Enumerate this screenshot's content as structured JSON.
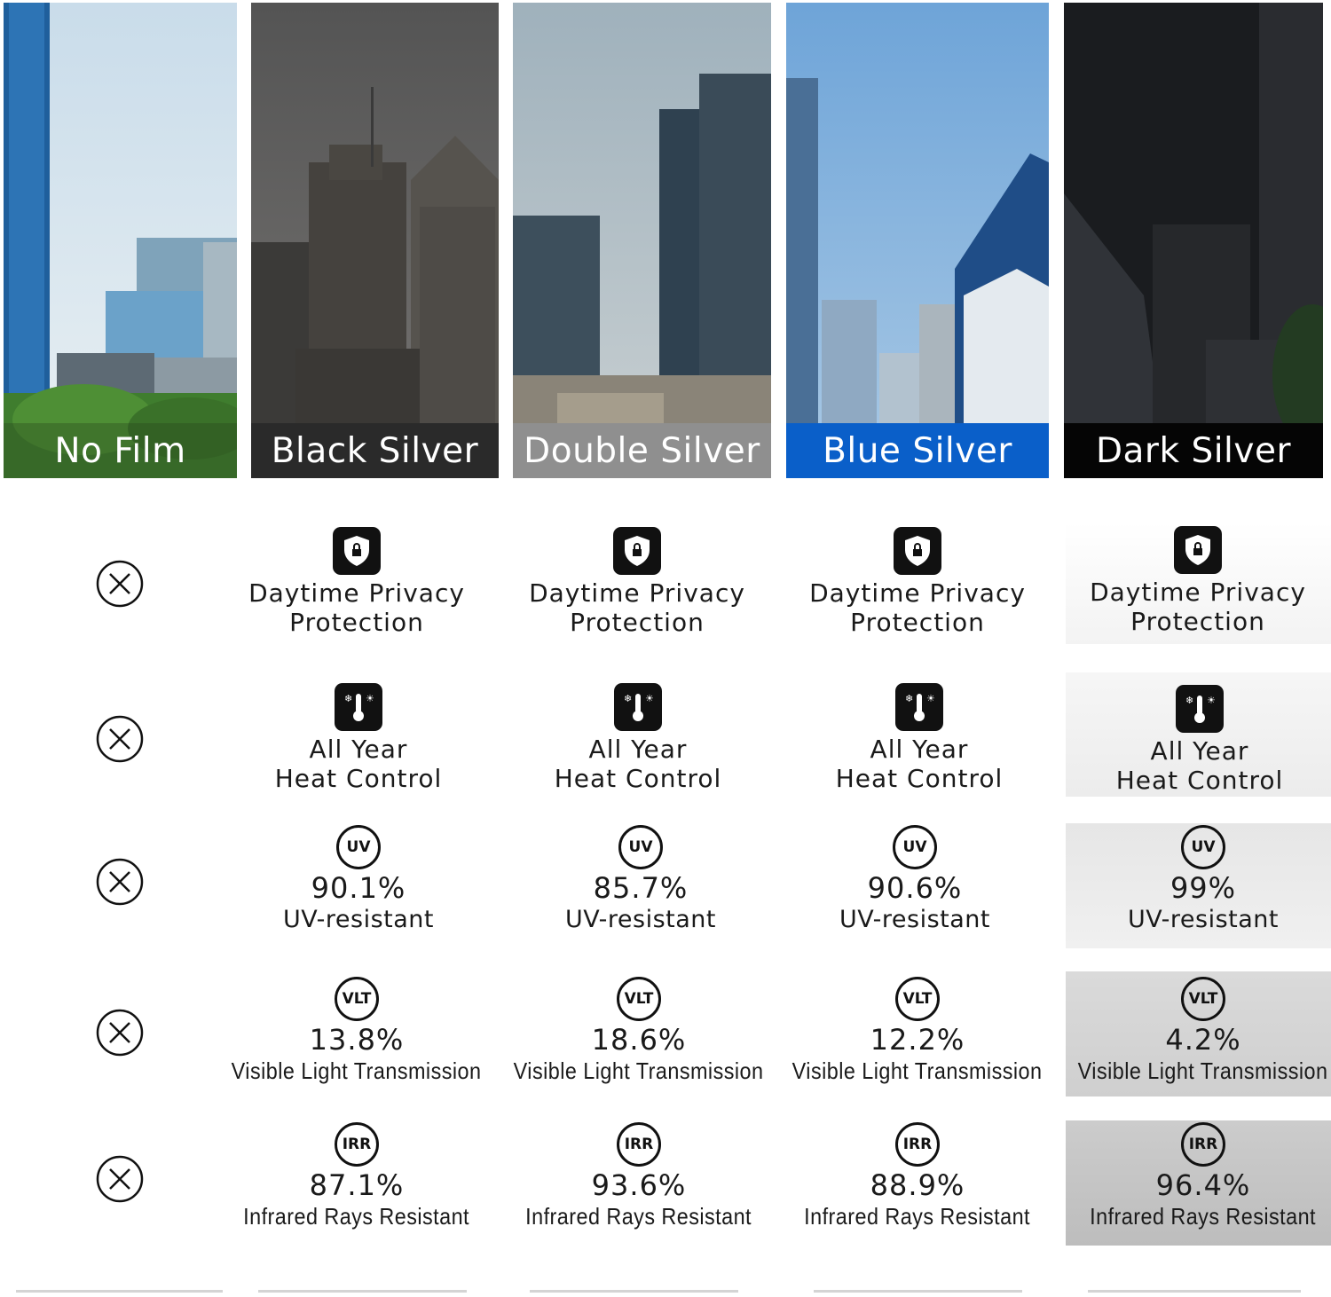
{
  "films": [
    {
      "name": "No Film",
      "band_color": "rgba(40,70,30,0.35)"
    },
    {
      "name": "Black Silver",
      "band_color": "#2a2a2a"
    },
    {
      "name": "Double Silver",
      "band_color": "#8f8f8f"
    },
    {
      "name": "Blue Silver",
      "band_color": "#0a5fc9"
    },
    {
      "name": "Dark Silver",
      "band_color": "#050505"
    }
  ],
  "features": {
    "privacy": {
      "line1": "Daytime Privacy",
      "line2": "Protection"
    },
    "heat": {
      "line1": "All Year",
      "line2": "Heat Control"
    },
    "uv": {
      "badge": "UV",
      "label": "UV-resistant"
    },
    "vlt": {
      "badge": "VLT",
      "label": "Visible Light Transmission"
    },
    "irr": {
      "badge": "IRR",
      "label": "Infrared Rays Resistant"
    }
  },
  "values": {
    "black_silver": {
      "uv": "90.1%",
      "vlt": "13.8%",
      "irr": "87.1%"
    },
    "double_silver": {
      "uv": "85.7%",
      "vlt": "18.6%",
      "irr": "93.6%"
    },
    "blue_silver": {
      "uv": "90.6%",
      "vlt": "12.2%",
      "irr": "88.9%"
    },
    "dark_silver": {
      "uv": "99%",
      "vlt": "4.2%",
      "irr": "96.4%"
    }
  },
  "icons": {
    "no_feature": "x-circle-icon",
    "privacy": "shield-lock-icon",
    "heat": "thermometer-icon"
  }
}
